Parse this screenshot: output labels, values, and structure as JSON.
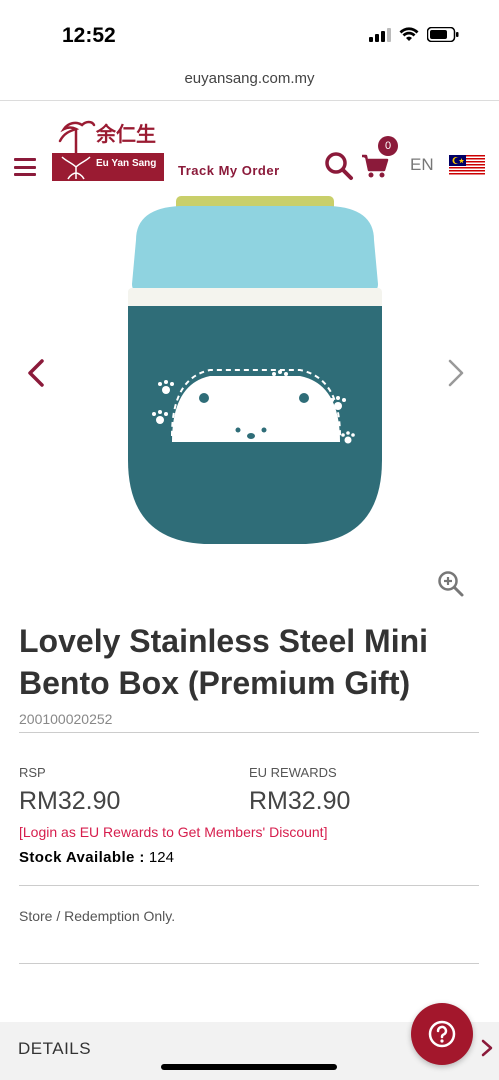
{
  "status_bar": {
    "time": "12:52",
    "url": "euyansang.com.my"
  },
  "header": {
    "logo_chinese": "余仁生",
    "logo_text": "Eu Yan Sang",
    "track_order": "Track My Order",
    "cart_count": "0",
    "language": "EN",
    "icons": [
      "menu-icon",
      "search-icon",
      "cart-icon",
      "malaysia-flag-icon"
    ],
    "brand_color": "#8b1a3a"
  },
  "product": {
    "title": "Lovely Stainless Steel Mini Bento Box (Premium Gift)",
    "sku": "200100020252",
    "rsp_label": "RSP",
    "rsp_price": "RM32.90",
    "eu_label": "EU REWARDS",
    "eu_price": "RM32.90",
    "login_note": "[Login as EU Rewards to Get Members' Discount]",
    "stock_label": "Stock Available :",
    "stock_value": "124",
    "store_note": "Store / Redemption Only."
  },
  "details": {
    "label": "DETAILS"
  },
  "colors": {
    "accent": "#8b1a3a",
    "link": "#d61e4d",
    "help_button": "#a3172c"
  }
}
